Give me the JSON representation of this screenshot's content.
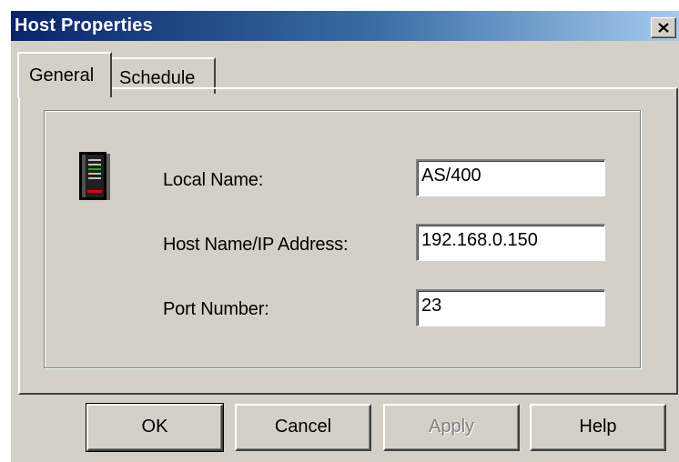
{
  "window": {
    "title": "Host Properties",
    "close_label": "close"
  },
  "tabs": [
    {
      "label": "General",
      "selected": true
    },
    {
      "label": "Schedule",
      "selected": false
    }
  ],
  "form": {
    "icon": "server-icon",
    "local_name_label": "Local Name:",
    "local_name_value": "AS/400",
    "host_label": "Host Name/IP Address:",
    "host_value": "192.168.0.150",
    "port_label": "Port Number:",
    "port_value": "23"
  },
  "buttons": {
    "ok": "OK",
    "cancel": "Cancel",
    "apply": "Apply",
    "apply_enabled": false,
    "help": "Help"
  },
  "colors": {
    "title_start": "#0a246a",
    "title_end": "#a6caf0",
    "face": "#d4d0c8"
  }
}
